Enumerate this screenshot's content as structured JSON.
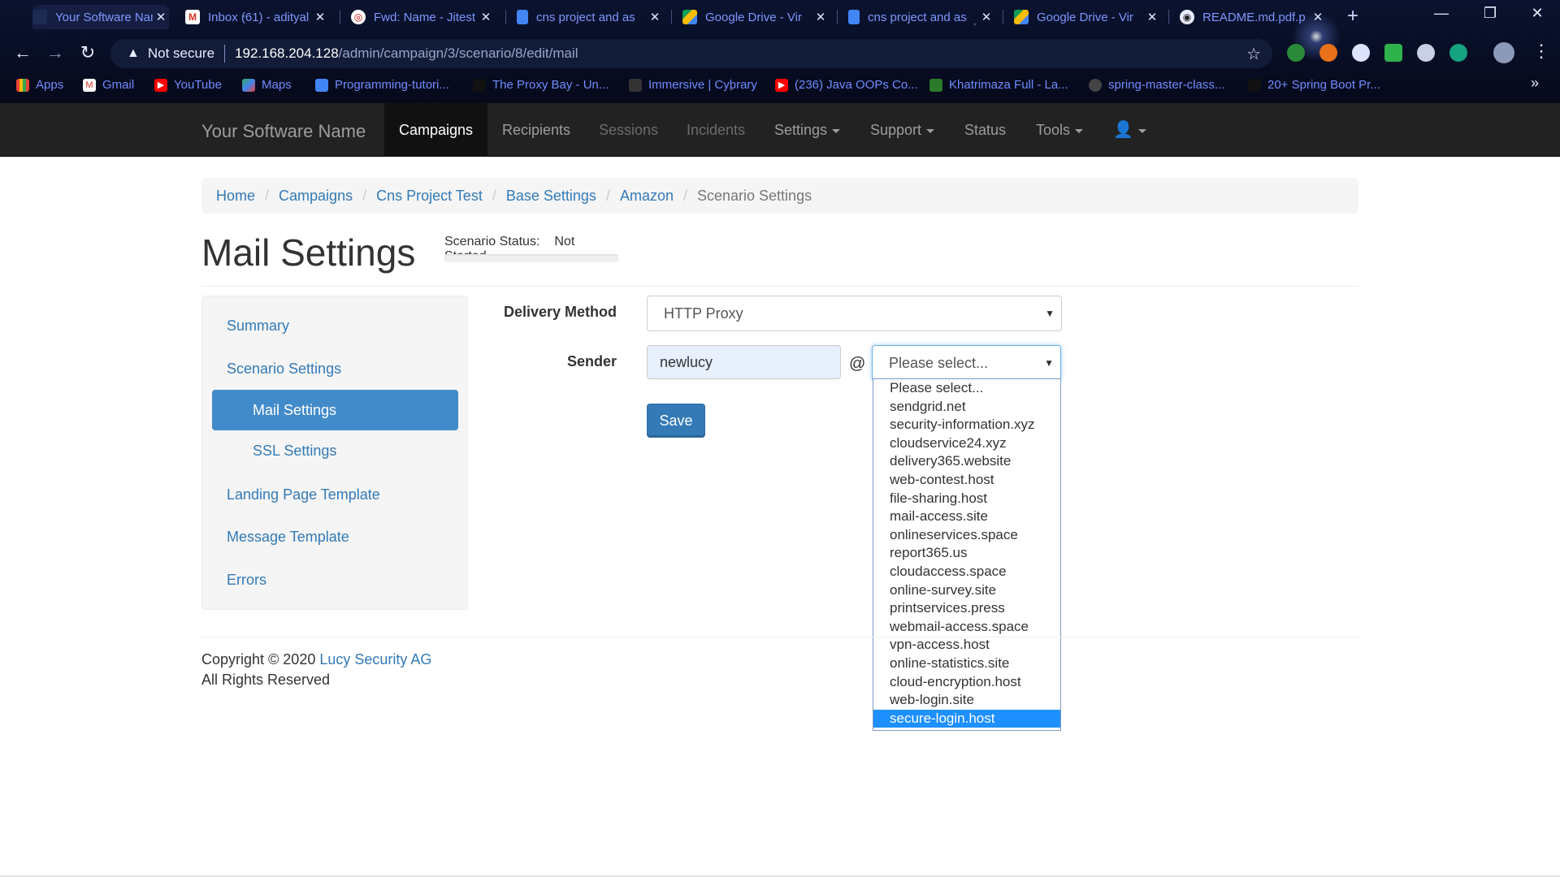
{
  "browser": {
    "tabs": [
      {
        "title": "Your Software Nam",
        "favicon": "app-icon"
      },
      {
        "title": "Inbox (61) - adityal",
        "favicon": "gmail-icon"
      },
      {
        "title": "Fwd: Name - Jitest",
        "favicon": "mail-icon"
      },
      {
        "title": "cns project and as",
        "favicon": "doc-icon"
      },
      {
        "title": "Google Drive - Vir",
        "favicon": "drive-icon"
      },
      {
        "title": "cns project and as",
        "favicon": "doc-icon"
      },
      {
        "title": "Google Drive - Vir",
        "favicon": "drive-icon"
      },
      {
        "title": "README.md.pdf.p",
        "favicon": "globe-icon"
      }
    ],
    "security_label": "Not secure",
    "url_host": "192.168.204.128",
    "url_path": "/admin/campaign/3/scenario/8/edit/mail",
    "bookmarks": [
      {
        "label": "Apps",
        "icon": "apps-grid-icon"
      },
      {
        "label": "Gmail",
        "icon": "gmail-icon"
      },
      {
        "label": "YouTube",
        "icon": "youtube-icon"
      },
      {
        "label": "Maps",
        "icon": "maps-icon"
      },
      {
        "label": "Programming-tutori...",
        "icon": "doc-icon"
      },
      {
        "label": "The Proxy Bay - Un...",
        "icon": "proxy-icon"
      },
      {
        "label": "Immersive | Cybrary",
        "icon": "cybrary-icon"
      },
      {
        "label": "(236) Java OOPs Co...",
        "icon": "youtube-icon"
      },
      {
        "label": "Khatrimaza Full - La...",
        "icon": "site-icon"
      },
      {
        "label": "spring-master-class...",
        "icon": "github-icon"
      },
      {
        "label": "20+ Spring Boot Pr...",
        "icon": "site-icon"
      }
    ]
  },
  "navbar": {
    "brand": "Your Software Name",
    "items": [
      {
        "label": "Campaigns",
        "state": "active"
      },
      {
        "label": "Recipients",
        "state": "normal"
      },
      {
        "label": "Sessions",
        "state": "dim"
      },
      {
        "label": "Incidents",
        "state": "dim"
      },
      {
        "label": "Settings",
        "state": "dropdown"
      },
      {
        "label": "Support",
        "state": "dropdown"
      },
      {
        "label": "Status",
        "state": "normal"
      },
      {
        "label": "Tools",
        "state": "dropdown"
      }
    ]
  },
  "breadcrumb": [
    "Home",
    "Campaigns",
    "Cns Project Test",
    "Base Settings",
    "Amazon",
    "Scenario Settings"
  ],
  "page": {
    "title": "Mail Settings",
    "status_label": "Scenario Status:",
    "status_value": "Not Started"
  },
  "sidebar": {
    "items": [
      "Summary",
      "Scenario Settings",
      "Mail Settings",
      "SSL Settings",
      "Landing Page Template",
      "Message Template",
      "Errors"
    ]
  },
  "form": {
    "delivery_label": "Delivery Method",
    "delivery_value": "HTTP Proxy",
    "sender_label": "Sender",
    "sender_value": "newlucy",
    "at_symbol": "@",
    "domain_value": "Please select...",
    "save_label": "Save",
    "domain_options": [
      "Please select...",
      "sendgrid.net",
      "security-information.xyz",
      "cloudservice24.xyz",
      "delivery365.website",
      "web-contest.host",
      "file-sharing.host",
      "mail-access.site",
      "onlineservices.space",
      "report365.us",
      "cloudaccess.space",
      "online-survey.site",
      "printservices.press",
      "webmail-access.space",
      "vpn-access.host",
      "online-statistics.site",
      "cloud-encryption.host",
      "web-login.site",
      "secure-login.host"
    ],
    "highlighted_option": "secure-login.host"
  },
  "footer": {
    "copyright": "Copyright © 2020",
    "company": "Lucy Security AG",
    "rights": "All Rights Reserved"
  },
  "colors": {
    "link": "#337ab7",
    "active_sidebar": "#428bca",
    "navbar_bg": "#222222",
    "highlight": "#1e90ff"
  }
}
